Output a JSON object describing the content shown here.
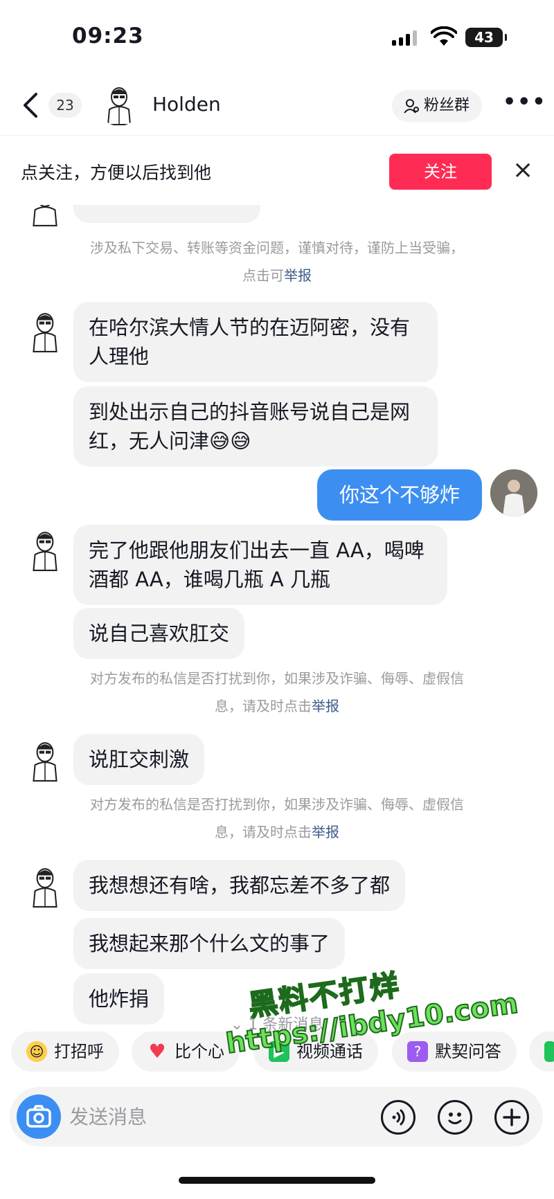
{
  "status": {
    "time": "09:23",
    "battery": "43"
  },
  "header": {
    "unread_count": "23",
    "contact_name": "Holden",
    "fans_group_label": "粉丝群"
  },
  "follow_bar": {
    "prompt": "点关注，方便以后找到他",
    "follow_label": "关注"
  },
  "chat": {
    "notice_fraud_text": "涉及私下交易、转账等资金问题，谨慎对待，谨防上当受骗，",
    "notice_fraud_prefix": "点击可",
    "report_label": "举报",
    "notice_harass_line1": "对方发布的私信是否打扰到你，如果涉及诈骗、侮辱、虚假信",
    "notice_harass_line2": "息，请及时点击",
    "messages": [
      {
        "from": "other",
        "text": "在哈尔滨大情人节的在迈阿密，没有人理他"
      },
      {
        "from": "other",
        "text": "到处出示自己的抖音账号说自己是网红，无人问津😅😅"
      },
      {
        "from": "self",
        "text": "你这个不够炸"
      },
      {
        "from": "other",
        "text": "完了他跟他朋友们出去一直 AA，喝啤酒都 AA，谁喝几瓶 A 几瓶"
      },
      {
        "from": "other",
        "text": "说自己喜欢肛交"
      },
      {
        "from": "other",
        "text": "说肛交刺激"
      },
      {
        "from": "other",
        "text": "我想想还有啥，我都忘差不多了都"
      },
      {
        "from": "other",
        "text": "我想起来那个什么文的事了"
      },
      {
        "from": "other",
        "text": "他炸捐"
      }
    ],
    "new_messages_label": "1 条新消息"
  },
  "quick_actions": [
    {
      "label": "打招呼",
      "icon": "wave-emoji-icon"
    },
    {
      "label": "比个心",
      "icon": "heart-icon"
    },
    {
      "label": "视频通话",
      "icon": "video-call-icon"
    },
    {
      "label": "默契问答",
      "icon": "quiz-icon"
    }
  ],
  "input": {
    "placeholder": "发送消息"
  },
  "watermark": {
    "line1": "黑料不打烊",
    "line2": "https://ibdy10.com"
  },
  "colors": {
    "follow": "#fe2c55",
    "self_bubble": "#3c8ff0",
    "camera": "#3b8ff3"
  }
}
